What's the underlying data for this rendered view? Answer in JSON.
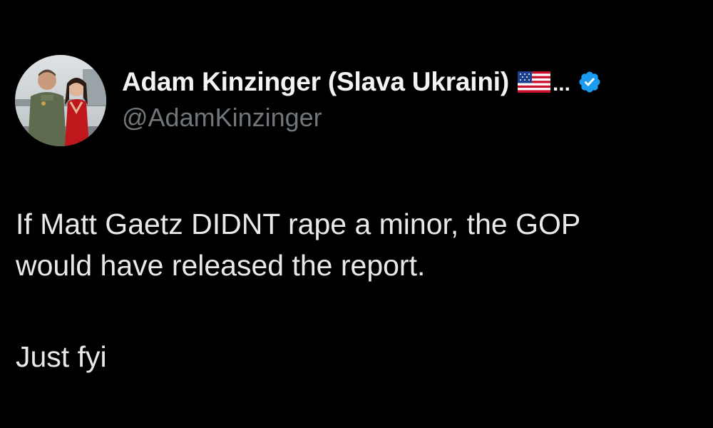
{
  "tweet": {
    "author": {
      "display_name": "Adam Kinzinger (Slava Ukraini)",
      "flag_icon": "us-flag-icon",
      "truncation": "...",
      "verified_icon": "verified-badge-icon",
      "verified_color": "#1d9bf0",
      "handle": "@AdamKinzinger"
    },
    "body": {
      "line1": "If Matt Gaetz DIDNT rape a minor, the GOP",
      "line2": "would have released the report.",
      "line3": "Just fyi"
    }
  },
  "colors": {
    "background": "#000000",
    "text_primary": "#e7e9ea",
    "text_secondary": "#71767b",
    "accent": "#1d9bf0"
  }
}
